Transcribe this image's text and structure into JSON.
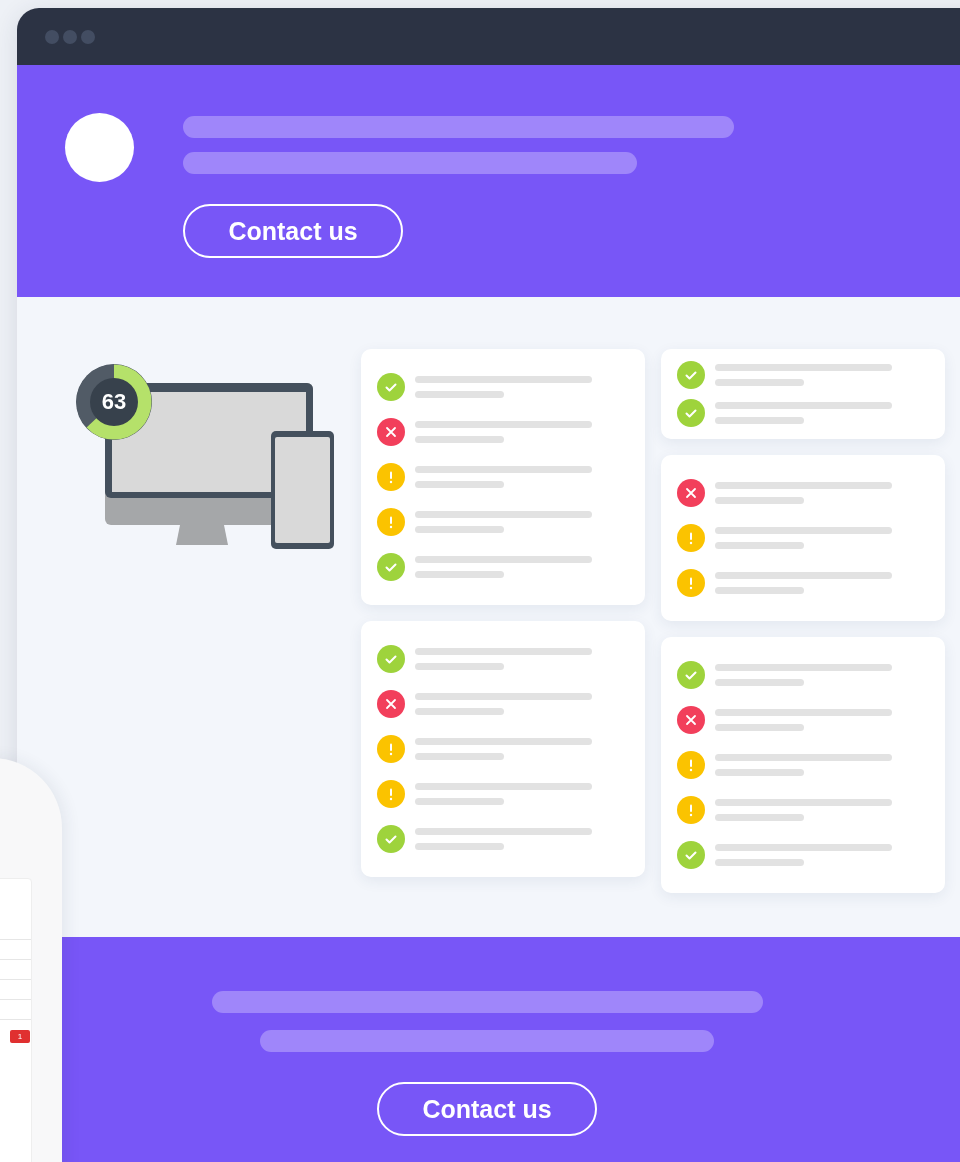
{
  "header": {
    "button": "Contact us"
  },
  "score": {
    "value": "63",
    "level": 0.63
  },
  "check_columns": [
    {
      "cards": [
        {
          "items": [
            {
              "kind": "pass"
            },
            {
              "kind": "fail"
            },
            {
              "kind": "warn"
            },
            {
              "kind": "warn"
            },
            {
              "kind": "pass"
            }
          ]
        },
        {
          "items": [
            {
              "kind": "pass"
            },
            {
              "kind": "fail"
            },
            {
              "kind": "warn"
            },
            {
              "kind": "warn"
            },
            {
              "kind": "pass"
            }
          ]
        }
      ]
    },
    {
      "cards": [
        {
          "items": [
            {
              "kind": "pass"
            },
            {
              "kind": "pass"
            }
          ]
        },
        {
          "items": [
            {
              "kind": "fail"
            },
            {
              "kind": "warn"
            },
            {
              "kind": "warn"
            }
          ]
        },
        {
          "items": [
            {
              "kind": "pass"
            },
            {
              "kind": "fail"
            },
            {
              "kind": "warn"
            },
            {
              "kind": "warn"
            },
            {
              "kind": "pass"
            }
          ]
        }
      ]
    }
  ],
  "footer": {
    "button": "Contact us"
  },
  "side_device": {
    "badge": "1"
  }
}
